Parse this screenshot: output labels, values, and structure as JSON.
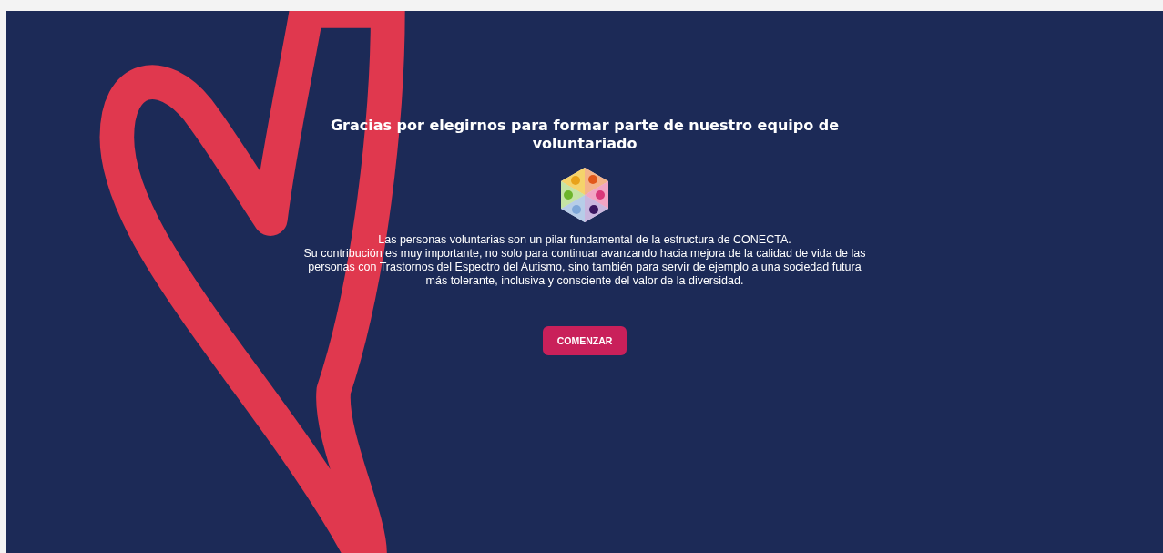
{
  "hero": {
    "title": "Gracias por elegirnos para formar parte de nuestro equipo de voluntariado",
    "intro": "Las personas voluntarias son un pilar fundamental de la estructura de CONECTA.",
    "body": "Su contribución es muy importante, no solo para continuar avanzando hacia mejora de la calidad de vida de las personas con Trastornos del Espectro del Autismo, sino también para servir de ejemplo a una sociedad futura más tolerante, inclusiva y consciente del valor de la diversidad.",
    "button": "COMENZAR"
  }
}
